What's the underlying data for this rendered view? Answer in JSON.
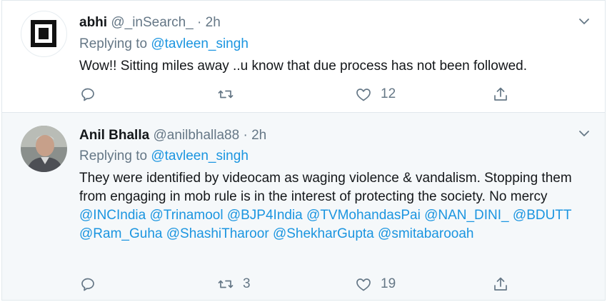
{
  "tweets": [
    {
      "name": "abhi",
      "handle": "@_inSearch_",
      "separator": "·",
      "time": "2h",
      "replying_prefix": "Replying to",
      "replying_to": "@tavleen_singh",
      "text": "Wow!! Sitting miles away ..u know that due process has not been followed.",
      "reply_count": "",
      "retweet_count": "",
      "like_count": "12"
    },
    {
      "name": "Anil Bhalla",
      "handle": "@anilbhalla88",
      "separator": "·",
      "time": "2h",
      "replying_prefix": "Replying to",
      "replying_to": "@tavleen_singh",
      "text_plain": "They were identified by videocam as waging violence & vandalism. Stopping them from engaging in mob rule is in the interest of protecting the society. No mercy",
      "mentions": [
        "@INCIndia",
        "@Trinamool",
        "@BJP4India",
        "@TVMohandasPai",
        "@NAN_DINI_",
        "@BDUTT",
        "@Ram_Guha",
        "@ShashiTharoor",
        "@ShekharGupta",
        "@smitabarooah"
      ],
      "reply_count": "",
      "retweet_count": "3",
      "like_count": "19"
    }
  ],
  "icons": {
    "reply": "reply-icon",
    "retweet": "retweet-icon",
    "like": "heart-icon",
    "share": "share-icon",
    "caret": "chevron-down-icon"
  },
  "colors": {
    "link": "#1b95e0",
    "muted": "#657786",
    "text": "#14171a",
    "selected_bg": "#f5f8fa",
    "border": "#e1e8ed"
  }
}
